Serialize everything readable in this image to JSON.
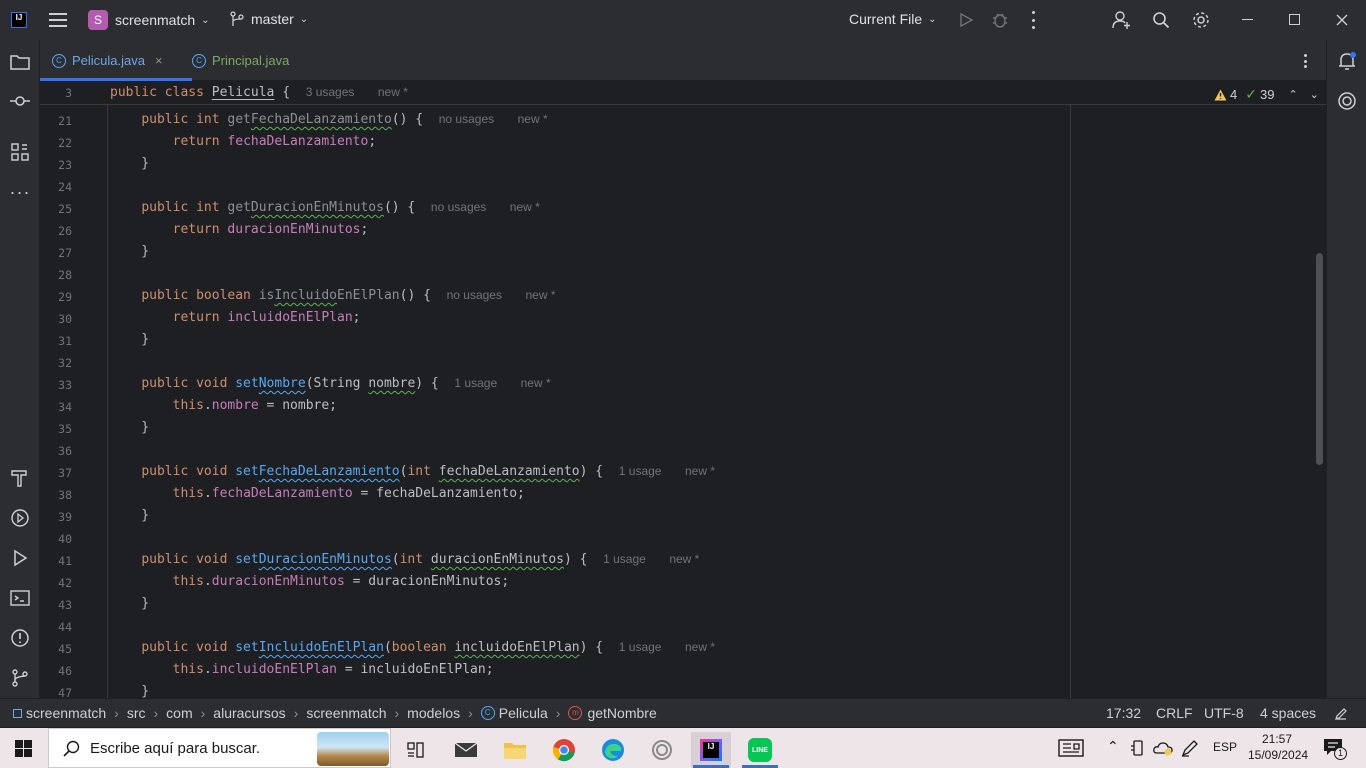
{
  "titlebar": {
    "project_badge": "S",
    "project_name": "screenmatch",
    "branch": "master",
    "run_config": "Current File"
  },
  "tabs": [
    {
      "label": "Pelicula.java",
      "active": true
    },
    {
      "label": "Principal.java",
      "active": false
    }
  ],
  "sticky": {
    "line_number": "3",
    "hint_usages": "3 usages",
    "hint_new": "new *"
  },
  "inspections": {
    "warnings": "4",
    "checks": "39"
  },
  "line_numbers": [
    "21",
    "22",
    "23",
    "24",
    "25",
    "26",
    "27",
    "28",
    "29",
    "30",
    "31",
    "32",
    "33",
    "34",
    "35",
    "36",
    "37",
    "38",
    "39",
    "40",
    "41",
    "42",
    "43",
    "44",
    "45",
    "46",
    "47"
  ],
  "hints": {
    "no_usages": "no usages",
    "one_usage": "1 usage",
    "new_marker": "new *"
  },
  "statusbar": {
    "breadcrumb": [
      "screenmatch",
      "src",
      "com",
      "aluracursos",
      "screenmatch",
      "modelos",
      "Pelicula",
      "getNombre"
    ],
    "position": "17:32",
    "line_ending": "CRLF",
    "encoding": "UTF-8",
    "indent": "4 spaces"
  },
  "taskbar": {
    "search_placeholder": "Escribe aquí para buscar.",
    "language": "ESP",
    "time": "21:57",
    "date": "15/09/2024",
    "notification_count": "1"
  },
  "colors": {
    "accent": "#3574f0",
    "keyword": "#cf8e6d",
    "method": "#56a8f5",
    "field": "#c77dbb"
  }
}
